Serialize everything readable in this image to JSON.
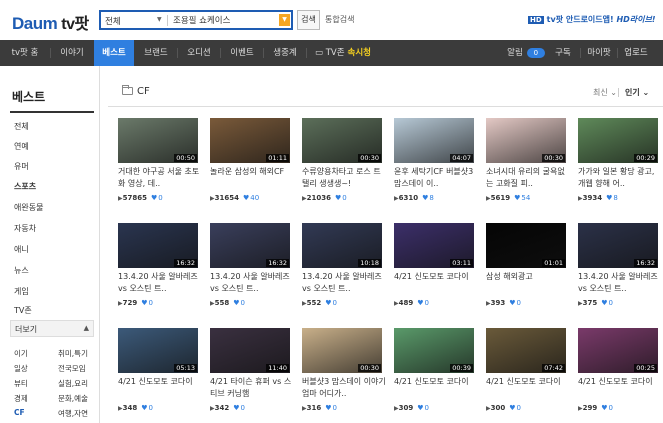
{
  "header": {
    "logo": "Daum",
    "service": "tv팟",
    "search_category": "전체",
    "search_query": "조용필 쇼케이스",
    "search_button": "검색",
    "integrated_search": "통합검색",
    "promo_badge": "HD",
    "promo_text": "tv팟 안드로이드앱!",
    "promo_live": "HD라이브!"
  },
  "nav": {
    "items": [
      "tv팟 홈",
      "이야기",
      "베스트",
      "브랜드",
      "오디션",
      "이벤트",
      "생중계",
      "TV존"
    ],
    "tvzone_highlight": "속시청",
    "right": [
      "알림",
      "구독",
      "마이팟",
      "업로드"
    ],
    "alert_count": "0"
  },
  "sidebar": {
    "title": "베스트",
    "categories": [
      "전체",
      "연예",
      "유머",
      "스포츠",
      "애완동물",
      "자동차",
      "애니",
      "뉴스",
      "게임",
      "TV존"
    ],
    "more_label": "더보기",
    "sub_left": [
      "이기",
      "일상",
      "뷰티",
      "경제",
      "CF"
    ],
    "sub_right": [
      "취미,특기",
      "전국모임",
      "실험,요리",
      "문화,예술",
      "여행,자연"
    ]
  },
  "main": {
    "section": "CF",
    "sort_recent": "최신",
    "sort_popular": "인기"
  },
  "videos": [
    {
      "title": "거대한 야구공 서울 초토화 영상, 데..",
      "views": "57865",
      "likes": "0",
      "duration": "00:50",
      "bg": "#6b7a6a"
    },
    {
      "title": "놀라운 삼성의 해외CF",
      "views": "31654",
      "likes": "40",
      "duration": "01:11",
      "bg": "#7a5a3a"
    },
    {
      "title": "수류양용차타고 로스 트 탤리 생생생~!",
      "views": "21036",
      "likes": "0",
      "duration": "00:30",
      "bg": "#5c6f5a"
    },
    {
      "title": "윤후 세탁기CF 버블샷3 맘스데이 이..",
      "views": "6310",
      "likes": "8",
      "duration": "04:07",
      "bg": "#b7c9d6"
    },
    {
      "title": "소녀시대 유리의 굴욕없는 고화질 피..",
      "views": "5619",
      "likes": "54",
      "duration": "00:30",
      "bg": "#e4c9c5"
    },
    {
      "title": "가가와 일본 황당 광고, 개웹 향해 어..",
      "views": "3934",
      "likes": "8",
      "duration": "00:29",
      "bg": "#5f8a5a"
    },
    {
      "title": "13.4.20 사울 알바레즈 vs 오스틴 트..",
      "views": "729",
      "likes": "0",
      "duration": "16:32",
      "bg": "#2a3550"
    },
    {
      "title": "13.4.20 사울 알바레즈 vs 오스틴 트..",
      "views": "558",
      "likes": "0",
      "duration": "16:32",
      "bg": "#3a3f5c"
    },
    {
      "title": "13.4.20 사울 알바레즈 vs 오스틴 트..",
      "views": "552",
      "likes": "0",
      "duration": "10:18",
      "bg": "#323a55"
    },
    {
      "title": "4/21 신도모토 코다이",
      "views": "489",
      "likes": "0",
      "duration": "03:11",
      "bg": "#3c2f6a"
    },
    {
      "title": "삼성 해외광고",
      "views": "393",
      "likes": "0",
      "duration": "01:01",
      "bg": "#050505"
    },
    {
      "title": "13.4.20 사울 알바레즈 vs 오스틴 트..",
      "views": "375",
      "likes": "0",
      "duration": "16:32",
      "bg": "#2b3148"
    },
    {
      "title": "4/21 신도모토 코다이",
      "views": "348",
      "likes": "0",
      "duration": "05:13",
      "bg": "#3c5a7a"
    },
    {
      "title": "4/21 타이슨 휴퍼 vs 스티브 커닝햄",
      "views": "342",
      "likes": "0",
      "duration": "11:40",
      "bg": "#3a3040"
    },
    {
      "title": "버블샷3 맘스데이 이야기 엄마 어디가..",
      "views": "316",
      "likes": "0",
      "duration": "00:30",
      "bg": "#c9b08a"
    },
    {
      "title": "4/21 신도모토 코다이",
      "views": "309",
      "likes": "0",
      "duration": "00:39",
      "bg": "#5a9a6a"
    },
    {
      "title": "4/21 신도모토 코다이",
      "views": "300",
      "likes": "0",
      "duration": "07:42",
      "bg": "#6a5a3a"
    },
    {
      "title": "4/21 신도모토 코다이",
      "views": "299",
      "likes": "0",
      "duration": "00:25",
      "bg": "#7a3a6a"
    }
  ]
}
